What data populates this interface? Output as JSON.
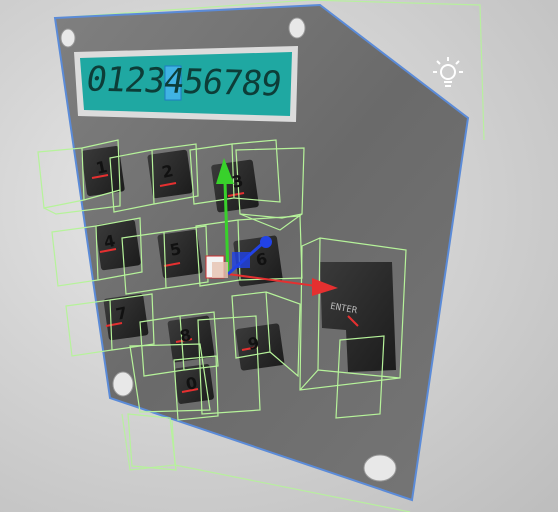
{
  "display": {
    "digits": "0123456789"
  },
  "keypad": {
    "keys": [
      {
        "label": "1"
      },
      {
        "label": "2"
      },
      {
        "label": "3"
      },
      {
        "label": "4"
      },
      {
        "label": "5"
      },
      {
        "label": "6"
      },
      {
        "label": "7"
      },
      {
        "label": "8"
      },
      {
        "label": "9"
      },
      {
        "label": "0"
      }
    ],
    "enter": {
      "label": "ENTER"
    }
  },
  "scene": {
    "light_icon": "sun-light-icon",
    "gizmo_icon": "move-gizmo-icon",
    "colors": {
      "panel": "#6e6e6e",
      "lcd": "#1fa8a2",
      "selection_outline": "#5b8bd8",
      "collider_wire": "#b6f39a",
      "gizmo_x": "#e53030",
      "gizmo_y": "#38d12b",
      "gizmo_z": "#2142e6"
    }
  }
}
